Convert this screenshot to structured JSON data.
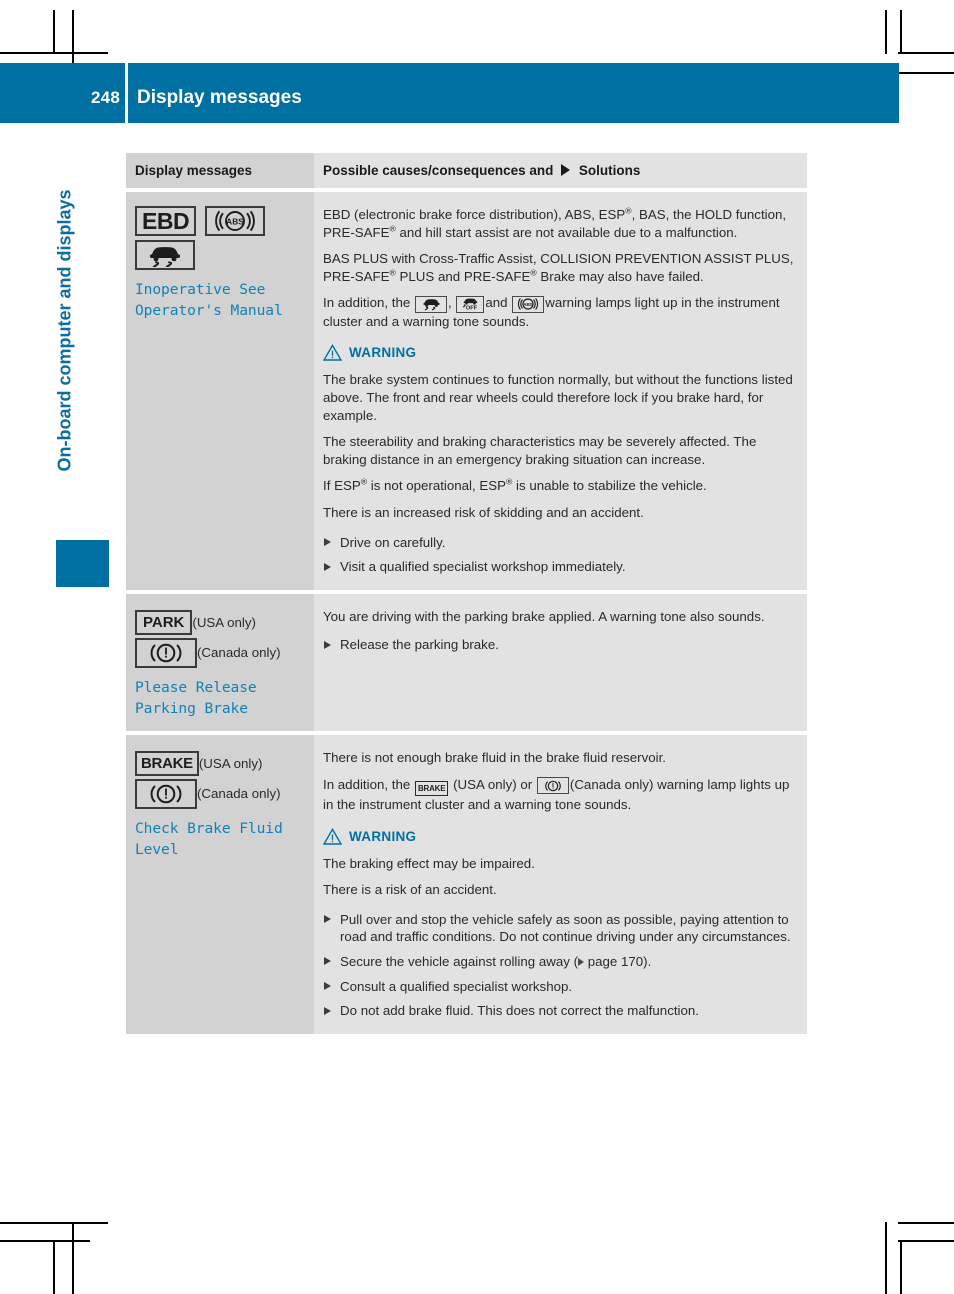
{
  "colors": {
    "brand_blue": "#0070a3",
    "chapter_blue": "#0d6ca2",
    "code_blue": "#0f83b8",
    "left_cell_gray": "#d2d2d2",
    "right_cell_gray": "#e2e2e2"
  },
  "header": {
    "page_number": "248",
    "title": "Display messages"
  },
  "side": {
    "chapter_title": "On-board computer and displays"
  },
  "table": {
    "columns": {
      "left": "Display messages",
      "right_pre": "Possible causes/consequences and",
      "right_post": "Solutions"
    },
    "rows": [
      {
        "symbols": [
          {
            "name": "ebd-symbol",
            "type": "text-box",
            "label": "EBD"
          },
          {
            "name": "abs-symbol",
            "type": "icon-box",
            "icon": "abs-warning-icon",
            "label": "ABS"
          },
          {
            "name": "esp-symbol",
            "type": "icon-box",
            "icon": "esp-skid-car-icon"
          }
        ],
        "message_code": "Inoperative See\nOperator's Manual",
        "message_code_lines": [
          "Inoperative See",
          "Operator's Manual"
        ],
        "body": [
          {
            "kind": "para",
            "id": "p1"
          },
          {
            "kind": "para",
            "id": "p2"
          },
          {
            "kind": "para",
            "id": "p3"
          },
          {
            "kind": "warning"
          },
          {
            "kind": "para",
            "id": "p4"
          },
          {
            "kind": "para",
            "id": "p5"
          },
          {
            "kind": "para",
            "id": "p6"
          },
          {
            "kind": "para",
            "id": "p7"
          },
          {
            "kind": "bullet",
            "id": "b1"
          },
          {
            "kind": "bullet",
            "id": "b2"
          }
        ],
        "text": {
          "p1_a": "EBD (electronic brake force distribution), ABS, ESP",
          "p1_sup1": "®",
          "p1_b": ", BAS, the HOLD function, PRE-SAFE",
          "p1_sup2": "®",
          "p1_c": " and hill start assist are not available due to a malfunction.",
          "p2_a": "BAS PLUS with Cross-Traffic Assist, COLLISION PREVENTION ASSIST PLUS, PRE-SAFE",
          "p2_sup1": "®",
          "p2_b": " PLUS and PRE-SAFE",
          "p2_sup2": "®",
          "p2_c": " Brake may also have failed.",
          "p3_a": "In addition, the",
          "p3_b": ",",
          "p3_c": "and",
          "p3_d": "warning lamps light up in the instrument cluster and a warning tone sounds.",
          "warning_label": "WARNING",
          "p4": "The brake system continues to function normally, but without the functions listed above. The front and rear wheels could therefore lock if you brake hard, for example.",
          "p5": "The steerability and braking characteristics may be severely affected. The braking distance in an emergency braking situation can increase.",
          "p6_a": "If ESP",
          "p6_sup1": "®",
          "p6_b": " is not operational, ESP",
          "p6_sup2": "®",
          "p6_c": " is unable to stabilize the vehicle.",
          "p7": "There is an increased risk of skidding and an accident.",
          "b1": "Drive on carefully.",
          "b2": "Visit a qualified specialist workshop immediately."
        }
      },
      {
        "symbols": [
          {
            "name": "park-symbol",
            "type": "text-box",
            "label": "PARK"
          },
          {
            "name": "brake-warning-symbol-canada",
            "type": "icon-box",
            "icon": "brake-warning-icon"
          }
        ],
        "left_notes": {
          "usa": "(USA only)",
          "canada": "(Canada only)"
        },
        "message_code_lines": [
          "Please Release",
          "Parking Brake"
        ],
        "text": {
          "p1": "You are driving with the parking brake applied. A warning tone also sounds.",
          "b1": "Release the parking brake."
        }
      },
      {
        "symbols": [
          {
            "name": "brake-text-symbol",
            "type": "text-box",
            "label": "BRAKE"
          },
          {
            "name": "brake-warning-symbol-canada",
            "type": "icon-box",
            "icon": "brake-warning-icon"
          }
        ],
        "left_notes": {
          "usa": "(USA only)",
          "canada": "(Canada only)"
        },
        "message_code_lines": [
          "Check Brake Fluid",
          "Level"
        ],
        "text": {
          "p1": "There is not enough brake fluid in the brake fluid reservoir.",
          "p2_a": "In addition, the",
          "p2_b": "(USA only) or",
          "p2_c": "(Canada only) warning lamp lights up in the instrument cluster and a warning tone sounds.",
          "warning_label": "WARNING",
          "p3": "The braking effect may be impaired.",
          "p4": "There is a risk of an accident.",
          "b1": "Pull over and stop the vehicle safely as soon as possible, paying attention to road and traffic conditions. Do not continue driving under any circumstances.",
          "b2_a": "Secure the vehicle against rolling away (",
          "b2_b": "page",
          "b2_c": "170).",
          "b3": "Consult a qualified specialist workshop.",
          "b4": "Do not add brake fluid. This does not correct the malfunction."
        }
      }
    ]
  }
}
